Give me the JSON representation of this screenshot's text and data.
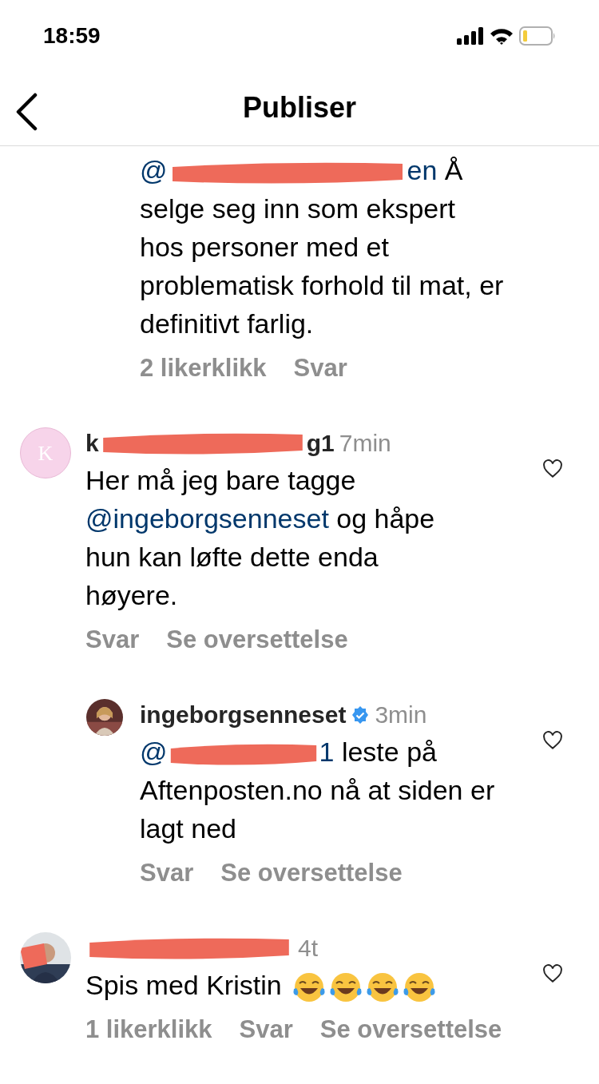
{
  "status_bar": {
    "time": "18:59"
  },
  "header": {
    "title": "Publiser"
  },
  "comments": [
    {
      "kind": "reply",
      "body": [
        {
          "kind": "mention",
          "text": "@"
        },
        {
          "kind": "redaction"
        },
        {
          "kind": "mention",
          "text": "en"
        },
        {
          "kind": "text",
          "text": " Å selge seg inn som ekspert hos personer med et problematisk forhold til mat, er definitivt farlig."
        }
      ],
      "actions": [
        "2 likerklikk",
        "Svar"
      ]
    },
    {
      "kind": "comment",
      "avatar": {
        "kind": "letter",
        "letter": "K"
      },
      "name_parts": [
        {
          "kind": "text",
          "text": "k"
        },
        {
          "kind": "redaction"
        },
        {
          "kind": "text",
          "text": "g1"
        }
      ],
      "time": "7min",
      "body": [
        {
          "kind": "text",
          "text": "Her må jeg bare tagge "
        },
        {
          "kind": "mention",
          "text": "@ingeborgsenneset"
        },
        {
          "kind": "text",
          "text": " og håpe hun kan løfte dette enda høyere."
        }
      ],
      "actions": [
        "Svar",
        "Se oversettelse"
      ]
    },
    {
      "kind": "reply",
      "avatar": {
        "kind": "picture"
      },
      "name_parts": [
        {
          "kind": "text",
          "text": "ingeborgsenneset"
        }
      ],
      "time": "3min",
      "verified": true,
      "body": [
        {
          "kind": "mention",
          "text": "@"
        },
        {
          "kind": "redaction"
        },
        {
          "kind": "mention",
          "text": "1"
        },
        {
          "kind": "text",
          "text": " leste på Aftenposten.no nå at siden er lagt ned"
        }
      ],
      "actions": [
        "Svar",
        "Se oversettelse"
      ]
    },
    {
      "kind": "comment",
      "avatar": {
        "kind": "picture"
      },
      "name_parts": [
        {
          "kind": "redaction"
        }
      ],
      "time": "4t",
      "body": [
        {
          "kind": "text",
          "text": "Spis med Kristin "
        },
        {
          "kind": "emoji"
        },
        {
          "kind": "emoji"
        },
        {
          "kind": "emoji"
        },
        {
          "kind": "emoji"
        }
      ],
      "actions": [
        "1 likerklikk",
        "Svar",
        "Se oversettelse"
      ]
    }
  ]
}
